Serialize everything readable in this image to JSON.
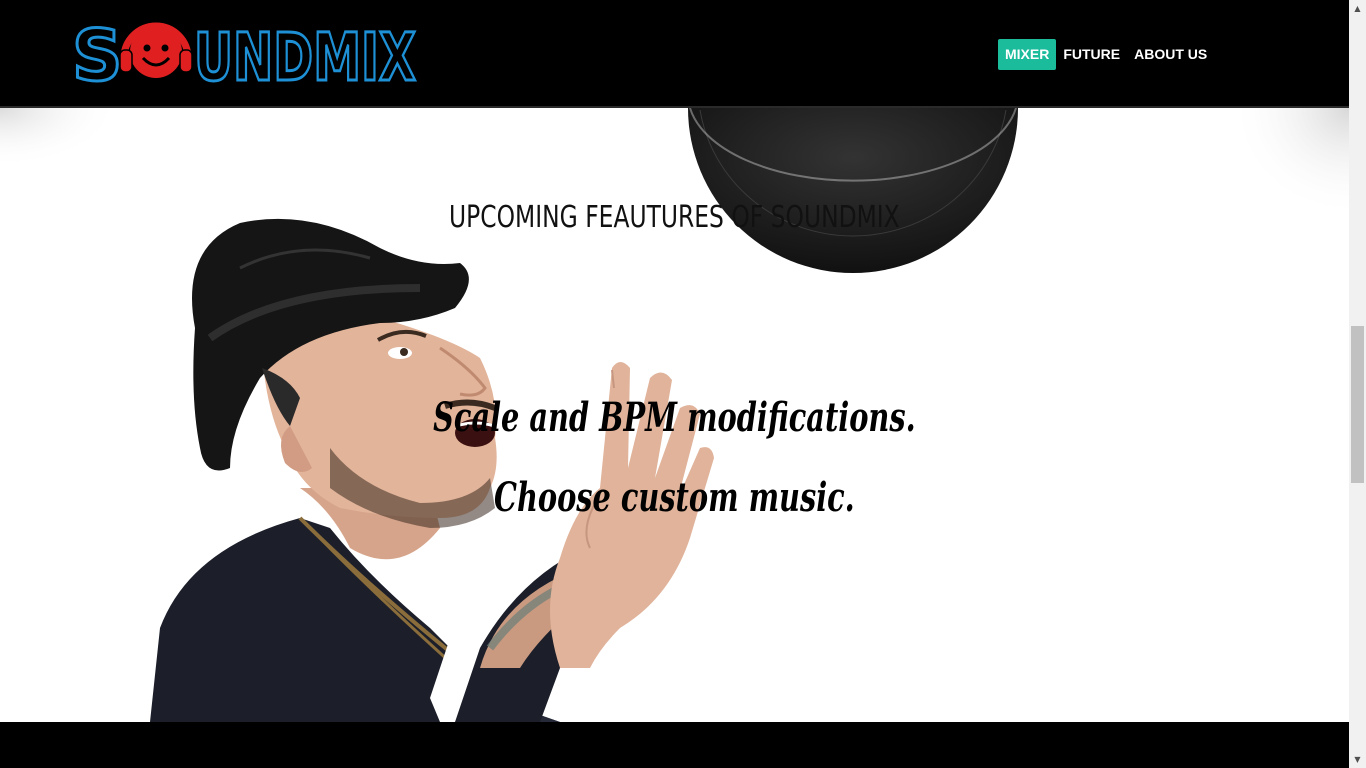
{
  "brand": {
    "logo_text": "SOUNDMIX",
    "logo_icon": "smiley-headphones-icon",
    "colors": {
      "logo_blue": "#1e90d6",
      "logo_red": "#e02020"
    }
  },
  "nav": {
    "items": [
      {
        "label": "MIXER",
        "active": true
      },
      {
        "label": "FUTURE",
        "active": false
      },
      {
        "label": "ABOUT US",
        "active": false
      }
    ],
    "active_color": "#1abc9c"
  },
  "hero": {
    "title": "UPCOMING FEAUTURES OF SOUNDMIX",
    "features": [
      "Scale and BPM modifications.",
      "Choose custom music."
    ],
    "image": "man-in-hat-photo"
  },
  "scrollbar": {
    "up_icon": "scroll-up-arrow-icon",
    "down_icon": "scroll-down-arrow-icon"
  }
}
